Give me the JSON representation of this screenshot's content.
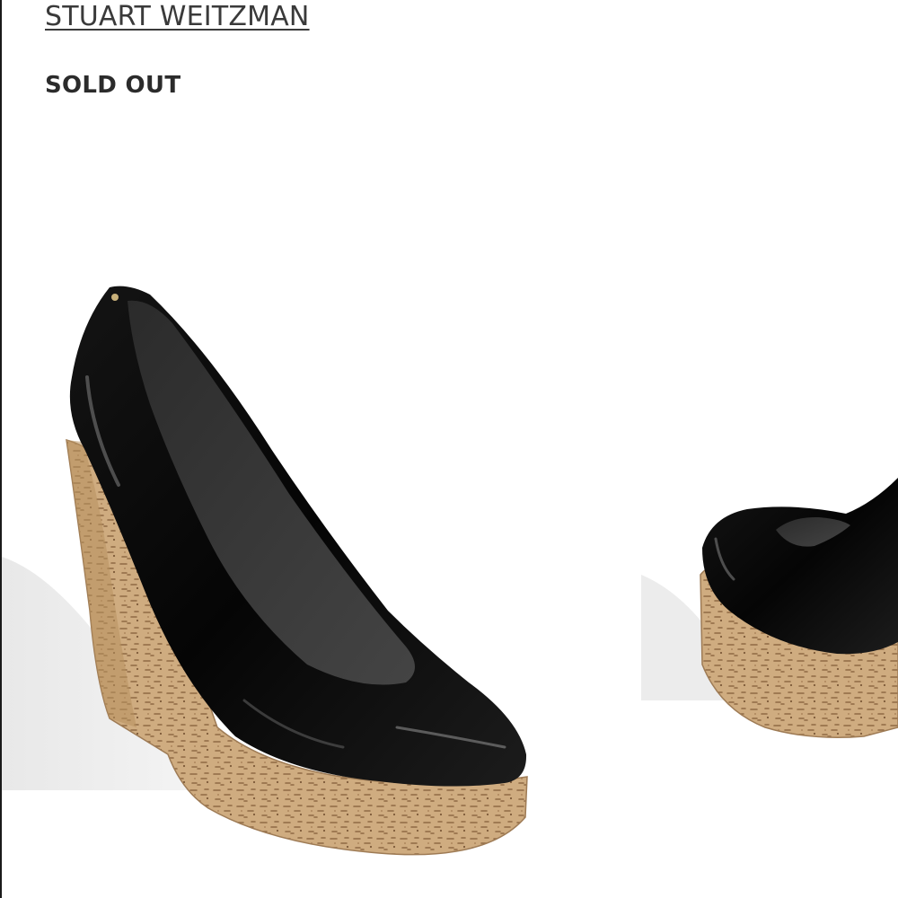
{
  "product": {
    "brand": "STUART WEITZMAN",
    "status": "SOLD OUT"
  },
  "photo": {
    "subject_icon": "wedge-pump-photo",
    "colors": {
      "patent_leather": "#0b0b0b",
      "cork": "#c9a57a",
      "background": "#ffffff"
    }
  }
}
